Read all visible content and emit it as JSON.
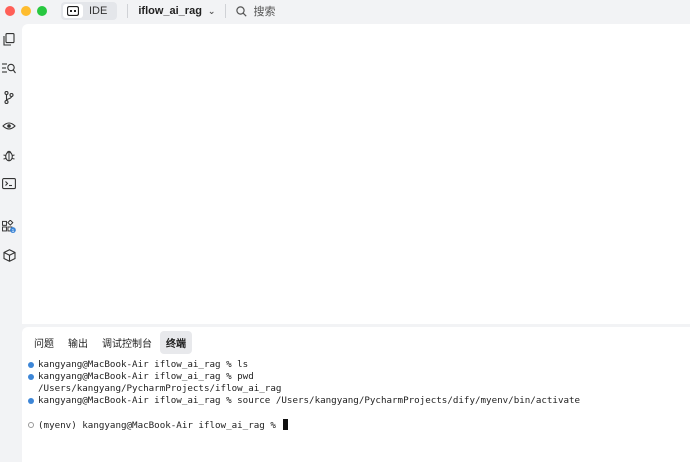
{
  "titlebar": {
    "mode_label": "IDE",
    "project_name": "iflow_ai_rag",
    "search_label": "搜索"
  },
  "sidebar": {
    "icons": [
      "files-icon",
      "search-code-icon",
      "git-branch-icon",
      "eye-icon",
      "bug-icon",
      "terminal-window-icon",
      "extensions-icon",
      "cube-icon"
    ],
    "extensions_badge": "1"
  },
  "panel": {
    "tabs": [
      {
        "label": "问题"
      },
      {
        "label": "输出"
      },
      {
        "label": "调试控制台"
      },
      {
        "label": "终端"
      }
    ],
    "active_tab": "终端"
  },
  "terminal": {
    "lines": [
      {
        "bullet": "filled",
        "text": "kangyang@MacBook-Air iflow_ai_rag % ls"
      },
      {
        "bullet": "filled",
        "text": "kangyang@MacBook-Air iflow_ai_rag % pwd"
      },
      {
        "bullet": "none",
        "text": "/Users/kangyang/PycharmProjects/iflow_ai_rag"
      },
      {
        "bullet": "filled",
        "text": "kangyang@MacBook-Air iflow_ai_rag % source /Users/kangyang/PycharmProjects/dify/myenv/bin/activate"
      },
      {
        "bullet": "none",
        "text": ""
      },
      {
        "bullet": "hollow",
        "text": "(myenv) kangyang@MacBook-Air iflow_ai_rag % "
      }
    ]
  },
  "colors": {
    "accent": "#3d86d7",
    "window_bg": "#f2f3f5"
  }
}
